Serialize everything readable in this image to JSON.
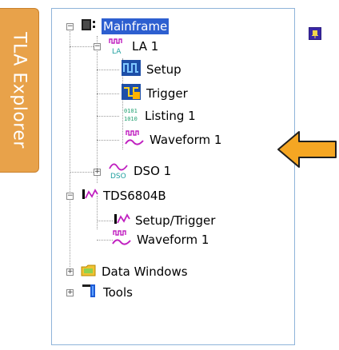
{
  "side_tab": {
    "label": "TLA Explorer"
  },
  "tree": {
    "mainframe": "Mainframe",
    "la1": "LA 1",
    "la1_badge": "LA",
    "setup": "Setup",
    "trigger": "Trigger",
    "listing1": "Listing 1",
    "listing_badge_top": "0101",
    "listing_badge_bottom": "1010",
    "waveform1_la": "Waveform 1",
    "dso1": "DSO 1",
    "dso_badge": "DSO",
    "tds": "TDS6804B",
    "setup_trigger": "Setup/Trigger",
    "waveform1_tds": "Waveform 1",
    "data_windows": "Data Windows",
    "tools": "Tools"
  },
  "colors": {
    "selected_bg": "#2d5fd0",
    "tab_orange": "#e8a24a",
    "arrow_orange": "#f5a623"
  }
}
